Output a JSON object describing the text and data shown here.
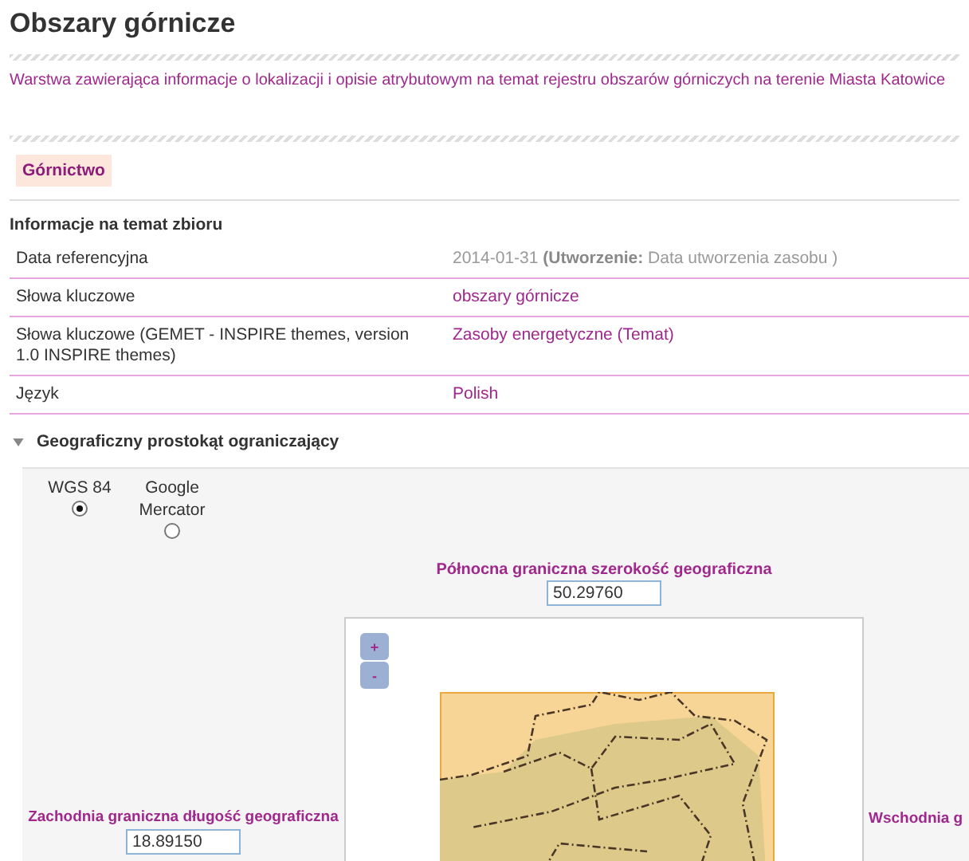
{
  "title": "Obszary górnicze",
  "description": "Warstwa zawierająca informacje o lokalizacji i opisie atrybutowym na temat rejestru obszarów górniczych na terenie Miasta Katowice",
  "tags": [
    {
      "label": "Górnictwo"
    }
  ],
  "info_section": {
    "heading": "Informacje na temat zbioru",
    "rows": [
      {
        "label": "Data referencyjna",
        "value": "2014-01-31 **(Utworzenie:** Data utworzenia zasobu )",
        "kind": "text"
      },
      {
        "label": "Słowa kluczowe",
        "value": "obszary górnicze",
        "kind": "link"
      },
      {
        "label": "Słowa kluczowe (GEMET - INSPIRE themes, version 1.0 INSPIRE themes)",
        "value": "Zasoby energetyczne (Temat)",
        "kind": "link"
      },
      {
        "label": "Język",
        "value": "Polish",
        "kind": "link"
      }
    ]
  },
  "bbox_section": {
    "heading": "Geograficzny prostokąt ograniczający",
    "expanded": true,
    "projections": [
      {
        "label": "WGS 84",
        "selected": true
      },
      {
        "label": "Google Mercator",
        "selected": false
      }
    ],
    "north": {
      "label": "Północna graniczna szerokość geograficzna",
      "value": "50.29760"
    },
    "west": {
      "label": "Zachodnia graniczna długość geograficzna",
      "value": "18.89150"
    },
    "east": {
      "label": "Wschodnia g"
    },
    "zoom_buttons": [
      "+",
      "-"
    ]
  }
}
